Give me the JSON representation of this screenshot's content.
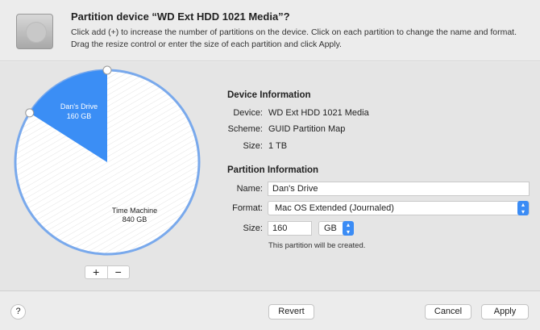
{
  "header": {
    "title": "Partition device “WD Ext HDD 1021 Media”?",
    "description": "Click add (+) to increase the number of partitions on the device. Click on each partition to change the name and format. Drag the resize control or enter the size of each partition and click Apply."
  },
  "pie": {
    "total_gb": 1000,
    "partitions": [
      {
        "name": "Dan's Drive",
        "size": "160 GB",
        "gb": 160,
        "color": "#3b8ef5"
      },
      {
        "name": "Time Machine",
        "size": "840 GB",
        "gb": 840,
        "color": "#ffffff"
      }
    ],
    "add": "+",
    "remove": "−"
  },
  "device": {
    "heading": "Device Information",
    "device_label": "Device:",
    "device": "WD Ext HDD 1021 Media",
    "scheme_label": "Scheme:",
    "scheme": "GUID Partition Map",
    "size_label": "Size:",
    "size": "1 TB"
  },
  "partition": {
    "heading": "Partition Information",
    "name_label": "Name:",
    "name": "Dan's Drive",
    "format_label": "Format:",
    "format": "Mac OS Extended (Journaled)",
    "size_label": "Size:",
    "size": "160",
    "unit": "GB",
    "note": "This partition will be created."
  },
  "footer": {
    "help": "?",
    "revert": "Revert",
    "cancel": "Cancel",
    "apply": "Apply"
  }
}
